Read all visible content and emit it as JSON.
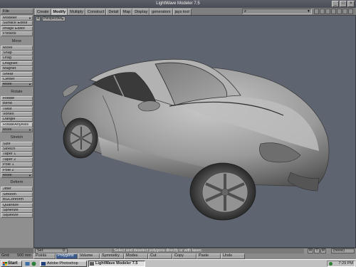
{
  "window": {
    "title": "LightWave Modeler 7.5",
    "min_label": "_",
    "max_label": "□",
    "close_label": "×"
  },
  "file_menu": "File",
  "tabs": [
    "Create",
    "Modify",
    "Multiply",
    "Construct",
    "Detail",
    "Map",
    "Display",
    "generators",
    "jays tool"
  ],
  "active_tab": "Modify",
  "layer_select": "z",
  "left_toolbar": {
    "modeler": "Modeler",
    "surface_editor": "Surface Editor",
    "image_editor": "Image Editor",
    "presets": "Presets",
    "move_header": "Move",
    "move_tools": [
      "Move",
      "Snap",
      "Drag",
      "DragNet",
      "Magnet",
      "Shear",
      "Center"
    ],
    "more1": "More",
    "rotate_header": "Rotate",
    "rotate_tools": [
      "Rotate",
      "Bend",
      "Twist",
      "Vortex",
      "Dangle",
      "RotateAnyAxis"
    ],
    "more2": "More",
    "stretch_header": "Stretch",
    "stretch_tools": [
      "Size",
      "Stretch",
      "Taper 1",
      "Taper 2",
      "Pole 1",
      "Pole 2"
    ],
    "more3": "More",
    "deform_header": "Deform",
    "deform_tools": [
      "Jitter",
      "Smooth",
      "BGConform",
      "Quantize",
      "Spherize",
      "Squeeze"
    ]
  },
  "viewport": {
    "number": "4",
    "view": "Perspective"
  },
  "status": {
    "sel_label": "Sel:",
    "sel_count": "0",
    "message": "Select and deselect polygons directly or with lasso.",
    "btn_w": "W",
    "btn_t": "T",
    "btn_m": "M",
    "none_select": "(none)"
  },
  "bottom_toolbar": {
    "grid_label": "Grid:",
    "grid_value": "500 mm",
    "buttons": [
      "Points",
      "Polygons",
      "Volume",
      "Symmetry",
      "Modes",
      "Cut",
      "Copy",
      "Paste",
      "Undo"
    ],
    "active": "Polygons"
  },
  "taskbar": {
    "start": "Start",
    "tasks": [
      "Adobe Photoshop",
      "LightWave Modeler 7.5"
    ],
    "active_task": "LightWave Modeler 7.5",
    "clock": "7:29 PM"
  },
  "colors": {
    "viewport_bg": "#5e6570",
    "active_mode": "#3c5b8a"
  }
}
